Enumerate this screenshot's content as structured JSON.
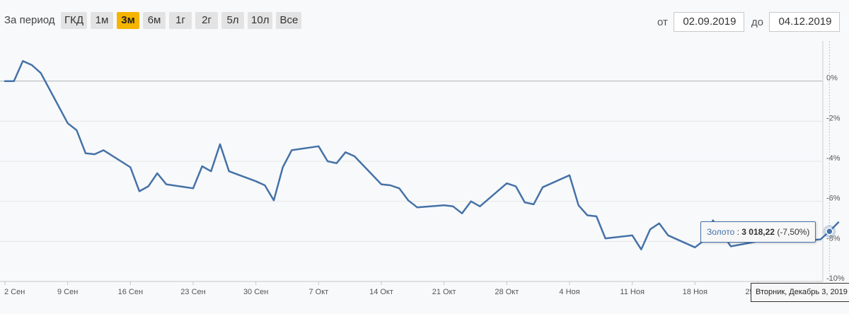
{
  "toolbar": {
    "period_label": "За период",
    "periods": [
      {
        "label": "ГКД",
        "active": false
      },
      {
        "label": "1м",
        "active": false
      },
      {
        "label": "3м",
        "active": true
      },
      {
        "label": "6м",
        "active": false
      },
      {
        "label": "1г",
        "active": false
      },
      {
        "label": "2г",
        "active": false
      },
      {
        "label": "5л",
        "active": false
      },
      {
        "label": "10л",
        "active": false
      },
      {
        "label": "Все",
        "active": false
      }
    ],
    "from_label": "от",
    "from_value": "02.09.2019",
    "to_label": "до",
    "to_value": "04.12.2019"
  },
  "tooltip": {
    "series_name": "Золото",
    "separator": " : ",
    "value": "3 018,22",
    "change": " (-7,50%)"
  },
  "xtip": "Вторник, Декабрь 3, 2019",
  "colors": {
    "line": "#4572a7",
    "active_button": "#f5b400",
    "grid": "#e6e6e6",
    "zero_line": "#b0b0b0"
  },
  "chart_data": {
    "type": "line",
    "title": "",
    "xlabel": "",
    "ylabel": "",
    "series": [
      {
        "name": "Золото",
        "x": [
          "2019-09-02",
          "2019-09-03",
          "2019-09-04",
          "2019-09-05",
          "2019-09-06",
          "2019-09-09",
          "2019-09-10",
          "2019-09-11",
          "2019-09-12",
          "2019-09-13",
          "2019-09-16",
          "2019-09-17",
          "2019-09-18",
          "2019-09-19",
          "2019-09-20",
          "2019-09-23",
          "2019-09-24",
          "2019-09-25",
          "2019-09-26",
          "2019-09-27",
          "2019-09-30",
          "2019-10-01",
          "2019-10-02",
          "2019-10-03",
          "2019-10-04",
          "2019-10-07",
          "2019-10-08",
          "2019-10-09",
          "2019-10-10",
          "2019-10-11",
          "2019-10-14",
          "2019-10-15",
          "2019-10-16",
          "2019-10-17",
          "2019-10-18",
          "2019-10-21",
          "2019-10-22",
          "2019-10-23",
          "2019-10-24",
          "2019-10-25",
          "2019-10-28",
          "2019-10-29",
          "2019-10-30",
          "2019-10-31",
          "2019-11-01",
          "2019-11-04",
          "2019-11-05",
          "2019-11-06",
          "2019-11-07",
          "2019-11-08",
          "2019-11-11",
          "2019-11-12",
          "2019-11-13",
          "2019-11-14",
          "2019-11-15",
          "2019-11-18",
          "2019-11-19",
          "2019-11-20",
          "2019-11-21",
          "2019-11-22",
          "2019-11-25",
          "2019-11-26",
          "2019-11-27",
          "2019-11-28",
          "2019-11-29",
          "2019-12-02",
          "2019-12-03",
          "2019-12-04"
        ],
        "values": [
          0.0,
          0.0,
          1.0,
          0.8,
          0.4,
          -2.1,
          -2.45,
          -3.6,
          -3.65,
          -3.45,
          -4.3,
          -5.5,
          -5.25,
          -4.6,
          -5.15,
          -5.35,
          -4.25,
          -4.5,
          -3.15,
          -4.5,
          -5.0,
          -5.2,
          -5.95,
          -4.3,
          -3.45,
          -3.25,
          -4.0,
          -4.1,
          -3.55,
          -3.75,
          -5.15,
          -5.2,
          -5.35,
          -5.95,
          -6.3,
          -6.2,
          -6.25,
          -6.6,
          -6.0,
          -6.25,
          -5.1,
          -5.25,
          -6.05,
          -6.15,
          -5.3,
          -4.7,
          -6.2,
          -6.7,
          -6.75,
          -7.85,
          -7.7,
          -8.4,
          -7.4,
          -7.1,
          -7.7,
          -8.3,
          -7.95,
          -6.95,
          -7.6,
          -8.25,
          -8.0,
          -7.85,
          -7.75,
          -7.7,
          -8.0,
          -7.9,
          -7.5,
          -7.05
        ]
      }
    ],
    "x_tick_labels": [
      "2 Сен",
      "9 Сен",
      "16 Сен",
      "23 Сен",
      "30 Сен",
      "7 Окт",
      "14 Окт",
      "21 Окт",
      "28 Окт",
      "4 Ноя",
      "11 Ноя",
      "18 Ноя",
      "25 Ноя"
    ],
    "x_tick_dates": [
      "2019-09-02",
      "2019-09-09",
      "2019-09-16",
      "2019-09-23",
      "2019-09-30",
      "2019-10-07",
      "2019-10-14",
      "2019-10-21",
      "2019-10-28",
      "2019-11-04",
      "2019-11-11",
      "2019-11-18",
      "2019-11-25"
    ],
    "y_tick_values": [
      0,
      -2,
      -4,
      -6,
      -8,
      -10
    ],
    "y_tick_labels": [
      "0%",
      "-2%",
      "-4%",
      "-6%",
      "-8%",
      "-10%"
    ],
    "xlim": [
      "2019-09-02",
      "2019-12-04"
    ],
    "ylim": [
      -10,
      2
    ],
    "y_unit": "%",
    "grid": true,
    "highlighted_point": {
      "x": "2019-12-03",
      "y": -7.5
    }
  }
}
